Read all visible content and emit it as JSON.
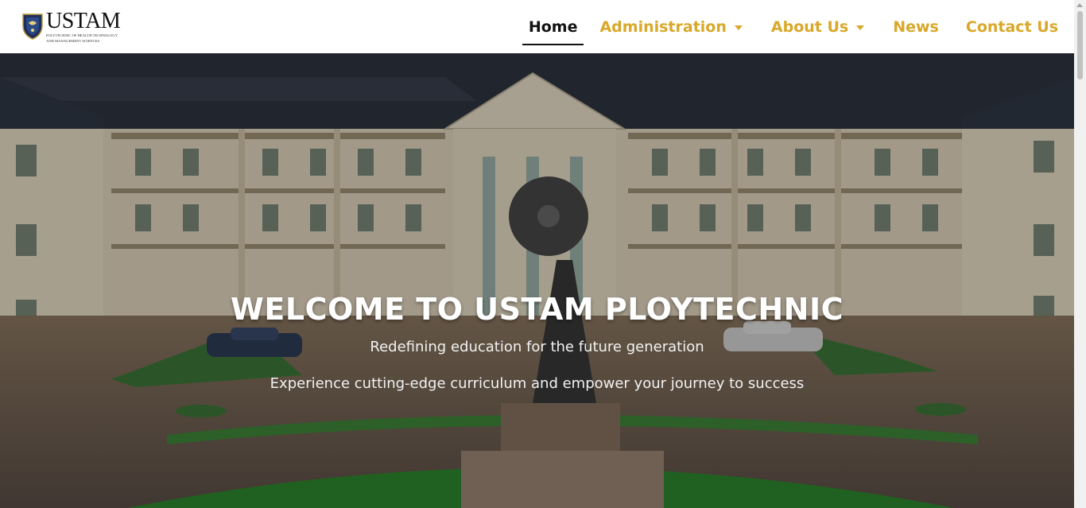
{
  "brand": {
    "name": "USTAM",
    "subtitle_line1": "Polytechnic of Health Technology",
    "subtitle_line2": "and Management Sciences",
    "logo_icon": "shield-crest-icon"
  },
  "nav": {
    "home": "Home",
    "administration": "Administration",
    "about": "About Us",
    "news": "News",
    "contact": "Contact Us",
    "active": "Home",
    "accent_color": "#d9a829",
    "active_color": "#111111"
  },
  "hero": {
    "title": "WELCOME TO USTAM PLOYTECHNIC",
    "subtitle": "Redefining education for the future generation",
    "description": "Experience cutting-edge curriculum and empower your journey to success",
    "background": "campus-building-photo"
  }
}
